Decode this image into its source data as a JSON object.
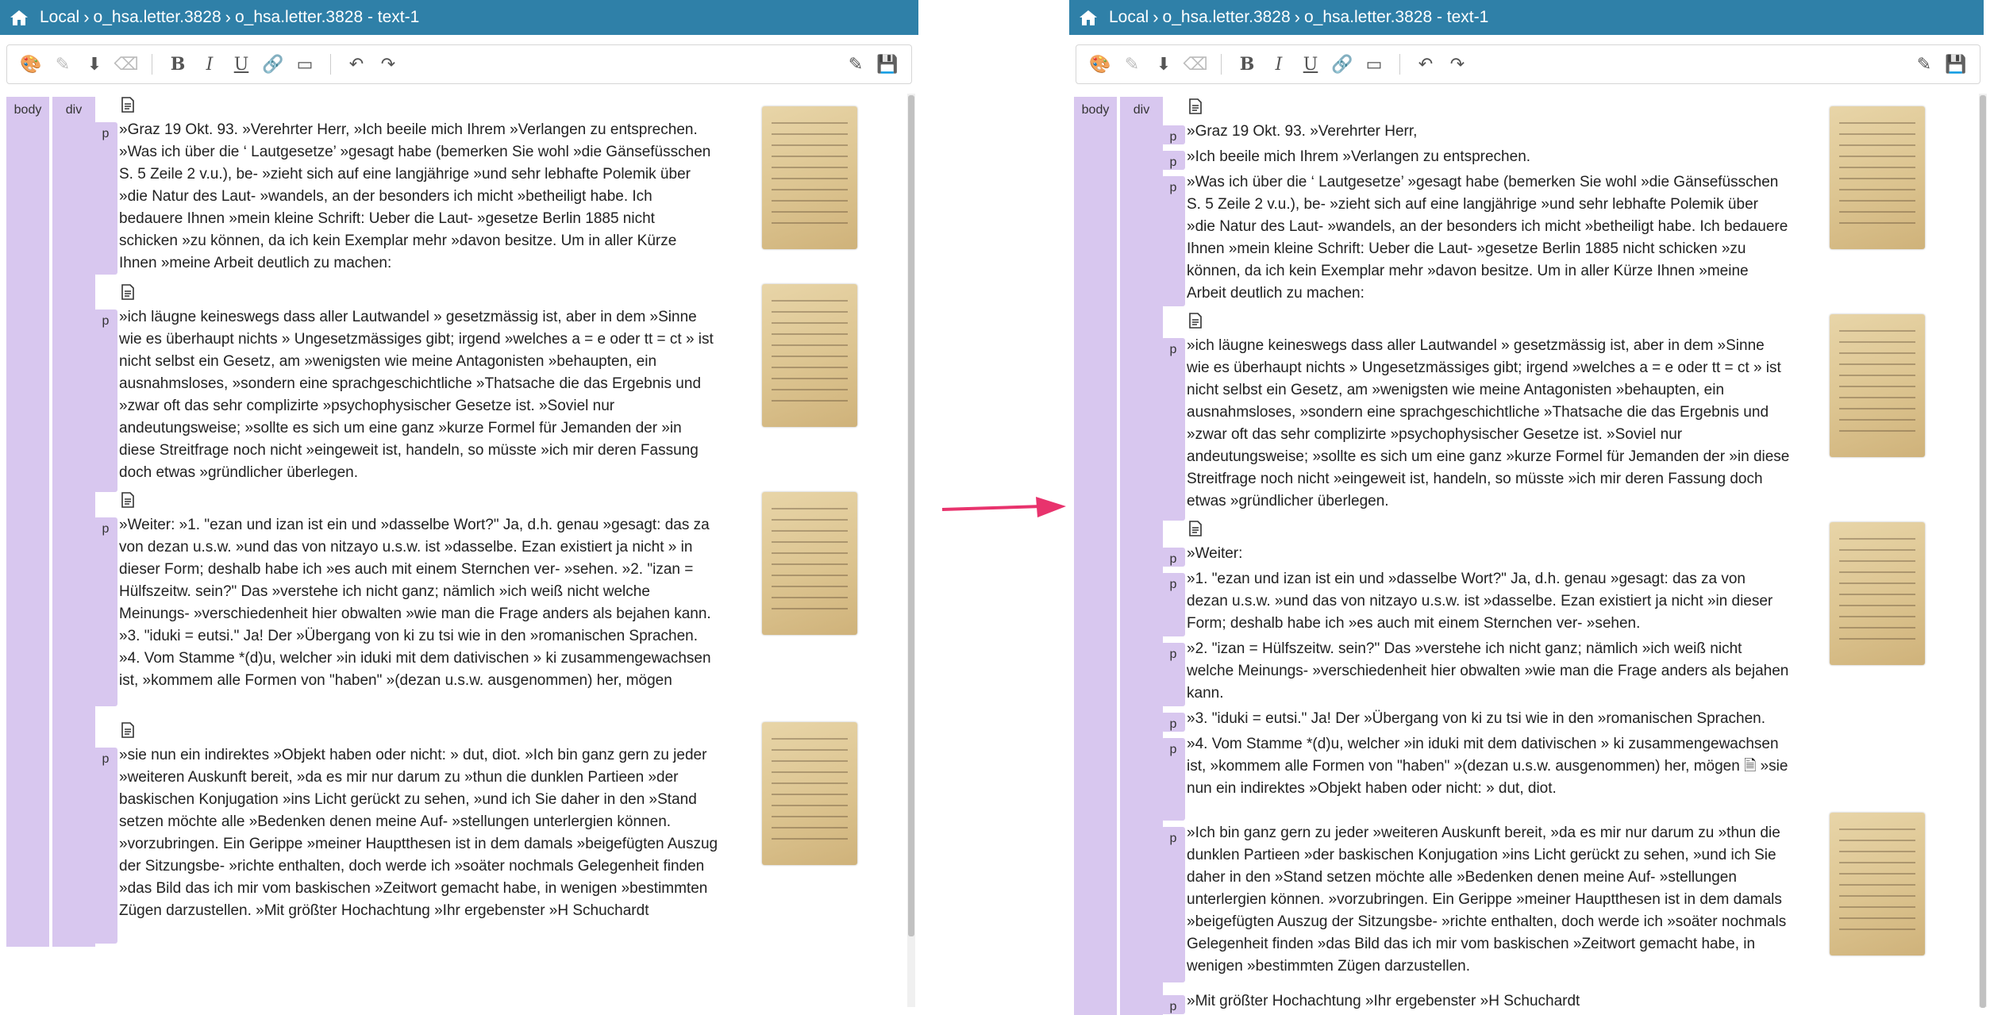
{
  "header": {
    "home_icon": "home-icon",
    "crumbs": [
      "Local",
      "o_hsa.letter.3828",
      "o_hsa.letter.3828 - text-1"
    ],
    "separator": "›"
  },
  "toolbar": {
    "icons": [
      "palette-icon",
      "dropper-icon",
      "stamp-icon",
      "eraser-icon",
      "bold-icon",
      "italic-icon",
      "underline-icon",
      "link-icon",
      "comment-icon",
      "undo-icon",
      "redo-icon",
      "edit-icon",
      "save-icon"
    ],
    "bold": "B",
    "italic": "I",
    "underline": "U"
  },
  "tags": {
    "body": "body",
    "div": "div",
    "p": "p"
  },
  "left": {
    "paragraphs": [
      "»Graz 19 Okt. 93. »Verehrter Herr, »Ich beeile mich Ihrem »Verlangen zu entsprechen. »Was ich über die ‘ Lautgesetze’ »gesagt habe (bemerken Sie wohl »die Gänsefüsschen S. 5 Zeile 2 v.u.), be- »zieht sich auf eine langjährige »und sehr lebhafte Polemik über »die Natur des Laut- »wandels, an der besonders ich micht »betheiligt habe. Ich bedauere Ihnen »mein kleine Schrift: Ueber die Laut- »gesetze Berlin 1885 nicht schicken »zu können, da ich kein Exemplar mehr »davon besitze. Um in aller Kürze Ihnen »meine Arbeit deutlich zu machen:",
      "»ich läugne keineswegs dass aller Lautwandel » gesetzmässig ist, aber in dem »Sinne wie es überhaupt nichts » Ungesetzmässiges gibt; irgend »welches a = e oder tt = ct » ist nicht selbst ein Gesetz, am »wenigsten wie meine Antagonisten »behaupten, ein ausnahmsloses, »sondern eine sprachgeschichtliche »Thatsache die das Ergebnis und »zwar oft das sehr complizirte »psychophysischer Gesetze ist. »Soviel nur andeutungsweise; »sollte es sich um eine ganz »kurze Formel für Jemanden der »in diese Streitfrage noch nicht »eingeweit ist, handeln, so müsste »ich mir deren Fassung doch etwas »gründlicher überlegen.",
      "»Weiter: »1. \"ezan und izan ist ein und »dasselbe Wort?\" Ja, d.h. genau »gesagt: das za von dezan u.s.w. »und das von nitzayo u.s.w. ist »dasselbe. Ezan existiert ja nicht » in dieser Form; deshalb habe ich »es auch mit einem Sternchen ver- »sehen. »2. \"izan = Hülfszeitw. sein?\" Das »verstehe ich nicht ganz; nämlich »ich weiß nicht welche Meinungs- »verschiedenheit hier obwalten »wie man die Frage anders als bejahen kann. »3. \"iduki = eutsi.\" Ja! Der »Übergang von ki zu tsi wie in den »romanischen Sprachen. »4. Vom Stamme *(d)u, welcher »in iduki mit dem dativischen » ki zusammengewachsen ist, »kommem alle Formen von \"haben\" »(dezan u.s.w. ausgenommen) her, mögen",
      "»sie nun ein indirektes »Objekt haben oder nicht: » dut, diot. »Ich bin ganz gern zu jeder »weiteren Auskunft bereit, »da es mir nur darum zu »thun die dunklen Partieen »der baskischen Konjugation »ins Licht gerückt zu sehen, »und ich Sie daher in den »Stand setzen möchte alle »Bedenken denen meine Auf- »stellungen unterlergien können. »vorzubringen. Ein Gerippe »meiner Hauptthesen ist in dem damals »beigefügten Auszug der Sitzungsbe- »richte enthalten, doch werde ich »soäter nochmals Gelegenheit finden »das Bild das ich mir vom baskischen »Zeitwort gemacht habe, in wenigen »bestimmten Zügen darzustellen. »Mit größter Hochachtung »Ihr ergebenster »H Schuchardt"
    ]
  },
  "right": {
    "paragraphs": [
      "»Graz 19 Okt. 93. »Verehrter Herr,",
      "»Ich beeile mich Ihrem »Verlangen zu entsprechen.",
      "»Was ich über die ‘ Lautgesetze’ »gesagt habe (bemerken Sie wohl »die Gänsefüsschen S. 5 Zeile 2 v.u.), be- »zieht sich auf eine langjährige »und sehr lebhafte Polemik über »die Natur des Laut- »wandels, an der besonders ich micht »betheiligt habe. Ich bedauere Ihnen »mein kleine Schrift: Ueber die Laut- »gesetze Berlin 1885 nicht schicken »zu können, da ich kein Exemplar mehr »davon besitze. Um in aller Kürze Ihnen »meine Arbeit deutlich zu machen:",
      "»ich läugne keineswegs dass aller Lautwandel » gesetzmässig ist, aber in dem »Sinne wie es überhaupt nichts » Ungesetzmässiges gibt; irgend »welches a = e oder tt = ct » ist nicht selbst ein Gesetz, am »wenigsten wie meine Antagonisten »behaupten, ein ausnahmsloses, »sondern eine sprachgeschichtliche »Thatsache die das Ergebnis und »zwar oft das sehr complizirte »psychophysischer Gesetze ist. »Soviel nur andeutungsweise; »sollte es sich um eine ganz »kurze Formel für Jemanden der »in diese Streitfrage noch nicht »eingeweit ist, handeln, so müsste »ich mir deren Fassung doch etwas »gründlicher überlegen.",
      "»Weiter:",
      "»1. \"ezan und izan ist ein und »dasselbe Wort?\" Ja, d.h. genau »gesagt: das za von dezan u.s.w. »und das von nitzayo u.s.w. ist »dasselbe. Ezan existiert ja nicht »in dieser Form; deshalb habe ich »es auch mit einem Sternchen ver- »sehen.",
      "»2. \"izan = Hülfszeitw. sein?\" Das »verstehe ich nicht ganz; nämlich »ich weiß nicht welche Meinungs- »verschiedenheit hier obwalten »wie man die Frage anders als bejahen kann.",
      "»3. \"iduki = eutsi.\" Ja! Der »Übergang von ki zu tsi wie in den »romanischen Sprachen.",
      "»4. Vom Stamme *(d)u, welcher »in iduki mit dem dativischen » ki zusammengewachsen ist, »kommem alle Formen von \"haben\" »(dezan u.s.w. ausgenommen) her, mögen 🗎 »sie nun ein indirektes »Objekt haben oder nicht: » dut, diot.",
      "»Ich bin ganz gern zu jeder »weiteren Auskunft bereit, »da es mir nur darum zu »thun die dunklen Partieen »der baskischen Konjugation »ins Licht gerückt zu sehen, »und ich Sie daher in den »Stand setzen möchte alle »Bedenken denen meine Auf- »stellungen unterlergien können. »vorzubringen. Ein Gerippe »meiner Hauptthesen ist in dem damals »beigefügten Auszug der Sitzungsbe- »richte enthalten, doch werde ich »soäter nochmals Gelegenheit finden »das Bild das ich mir vom baskischen »Zeitwort gemacht habe, in wenigen »bestimmten Zügen darzustellen.",
      "»Mit größter Hochachtung »Ihr ergebenster »H Schuchardt"
    ]
  },
  "colors": {
    "header": "#2f80a8",
    "tag": "#d8c7ef",
    "arrow": "#e8336d",
    "underline": "#3a6fc4"
  }
}
